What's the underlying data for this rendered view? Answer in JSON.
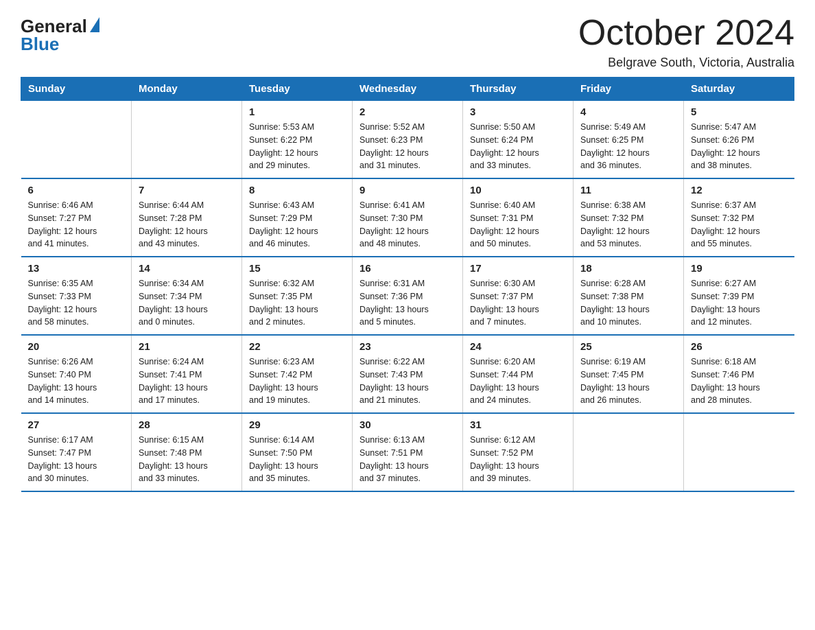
{
  "header": {
    "logo_general": "General",
    "logo_blue": "Blue",
    "month_title": "October 2024",
    "location": "Belgrave South, Victoria, Australia"
  },
  "days_of_week": [
    "Sunday",
    "Monday",
    "Tuesday",
    "Wednesday",
    "Thursday",
    "Friday",
    "Saturday"
  ],
  "weeks": [
    [
      {
        "day": "",
        "info": ""
      },
      {
        "day": "",
        "info": ""
      },
      {
        "day": "1",
        "info": "Sunrise: 5:53 AM\nSunset: 6:22 PM\nDaylight: 12 hours\nand 29 minutes."
      },
      {
        "day": "2",
        "info": "Sunrise: 5:52 AM\nSunset: 6:23 PM\nDaylight: 12 hours\nand 31 minutes."
      },
      {
        "day": "3",
        "info": "Sunrise: 5:50 AM\nSunset: 6:24 PM\nDaylight: 12 hours\nand 33 minutes."
      },
      {
        "day": "4",
        "info": "Sunrise: 5:49 AM\nSunset: 6:25 PM\nDaylight: 12 hours\nand 36 minutes."
      },
      {
        "day": "5",
        "info": "Sunrise: 5:47 AM\nSunset: 6:26 PM\nDaylight: 12 hours\nand 38 minutes."
      }
    ],
    [
      {
        "day": "6",
        "info": "Sunrise: 6:46 AM\nSunset: 7:27 PM\nDaylight: 12 hours\nand 41 minutes."
      },
      {
        "day": "7",
        "info": "Sunrise: 6:44 AM\nSunset: 7:28 PM\nDaylight: 12 hours\nand 43 minutes."
      },
      {
        "day": "8",
        "info": "Sunrise: 6:43 AM\nSunset: 7:29 PM\nDaylight: 12 hours\nand 46 minutes."
      },
      {
        "day": "9",
        "info": "Sunrise: 6:41 AM\nSunset: 7:30 PM\nDaylight: 12 hours\nand 48 minutes."
      },
      {
        "day": "10",
        "info": "Sunrise: 6:40 AM\nSunset: 7:31 PM\nDaylight: 12 hours\nand 50 minutes."
      },
      {
        "day": "11",
        "info": "Sunrise: 6:38 AM\nSunset: 7:32 PM\nDaylight: 12 hours\nand 53 minutes."
      },
      {
        "day": "12",
        "info": "Sunrise: 6:37 AM\nSunset: 7:32 PM\nDaylight: 12 hours\nand 55 minutes."
      }
    ],
    [
      {
        "day": "13",
        "info": "Sunrise: 6:35 AM\nSunset: 7:33 PM\nDaylight: 12 hours\nand 58 minutes."
      },
      {
        "day": "14",
        "info": "Sunrise: 6:34 AM\nSunset: 7:34 PM\nDaylight: 13 hours\nand 0 minutes."
      },
      {
        "day": "15",
        "info": "Sunrise: 6:32 AM\nSunset: 7:35 PM\nDaylight: 13 hours\nand 2 minutes."
      },
      {
        "day": "16",
        "info": "Sunrise: 6:31 AM\nSunset: 7:36 PM\nDaylight: 13 hours\nand 5 minutes."
      },
      {
        "day": "17",
        "info": "Sunrise: 6:30 AM\nSunset: 7:37 PM\nDaylight: 13 hours\nand 7 minutes."
      },
      {
        "day": "18",
        "info": "Sunrise: 6:28 AM\nSunset: 7:38 PM\nDaylight: 13 hours\nand 10 minutes."
      },
      {
        "day": "19",
        "info": "Sunrise: 6:27 AM\nSunset: 7:39 PM\nDaylight: 13 hours\nand 12 minutes."
      }
    ],
    [
      {
        "day": "20",
        "info": "Sunrise: 6:26 AM\nSunset: 7:40 PM\nDaylight: 13 hours\nand 14 minutes."
      },
      {
        "day": "21",
        "info": "Sunrise: 6:24 AM\nSunset: 7:41 PM\nDaylight: 13 hours\nand 17 minutes."
      },
      {
        "day": "22",
        "info": "Sunrise: 6:23 AM\nSunset: 7:42 PM\nDaylight: 13 hours\nand 19 minutes."
      },
      {
        "day": "23",
        "info": "Sunrise: 6:22 AM\nSunset: 7:43 PM\nDaylight: 13 hours\nand 21 minutes."
      },
      {
        "day": "24",
        "info": "Sunrise: 6:20 AM\nSunset: 7:44 PM\nDaylight: 13 hours\nand 24 minutes."
      },
      {
        "day": "25",
        "info": "Sunrise: 6:19 AM\nSunset: 7:45 PM\nDaylight: 13 hours\nand 26 minutes."
      },
      {
        "day": "26",
        "info": "Sunrise: 6:18 AM\nSunset: 7:46 PM\nDaylight: 13 hours\nand 28 minutes."
      }
    ],
    [
      {
        "day": "27",
        "info": "Sunrise: 6:17 AM\nSunset: 7:47 PM\nDaylight: 13 hours\nand 30 minutes."
      },
      {
        "day": "28",
        "info": "Sunrise: 6:15 AM\nSunset: 7:48 PM\nDaylight: 13 hours\nand 33 minutes."
      },
      {
        "day": "29",
        "info": "Sunrise: 6:14 AM\nSunset: 7:50 PM\nDaylight: 13 hours\nand 35 minutes."
      },
      {
        "day": "30",
        "info": "Sunrise: 6:13 AM\nSunset: 7:51 PM\nDaylight: 13 hours\nand 37 minutes."
      },
      {
        "day": "31",
        "info": "Sunrise: 6:12 AM\nSunset: 7:52 PM\nDaylight: 13 hours\nand 39 minutes."
      },
      {
        "day": "",
        "info": ""
      },
      {
        "day": "",
        "info": ""
      }
    ]
  ]
}
